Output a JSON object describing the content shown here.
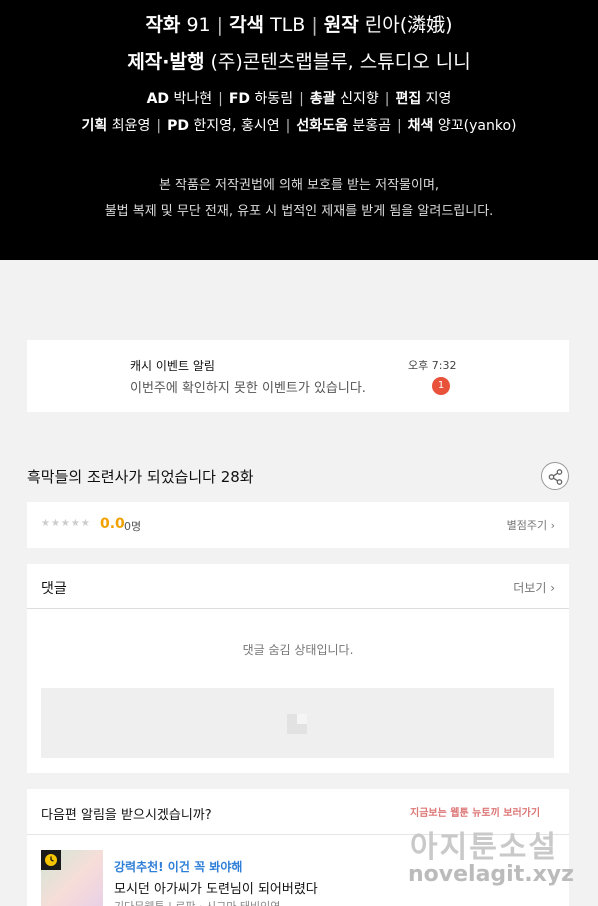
{
  "credits": {
    "line1": [
      {
        "role": "작화",
        "name": "91"
      },
      {
        "role": "각색",
        "name": "TLB"
      },
      {
        "role": "원작",
        "name": "린아(潾娥)"
      }
    ],
    "line2": {
      "role": "제작·발행",
      "name": "(주)콘텐츠랩블루, 스튜디오 니니"
    },
    "line3": [
      {
        "role": "AD",
        "name": "박나현"
      },
      {
        "role": "FD",
        "name": "하동림"
      },
      {
        "role": "총괄",
        "name": "신지향"
      },
      {
        "role": "편집",
        "name": "지영"
      }
    ],
    "line4": [
      {
        "role": "기획",
        "name": "최윤영"
      },
      {
        "role": "PD",
        "name": "한지영, 홍시연"
      },
      {
        "role": "선화도움",
        "name": "분홍곰"
      },
      {
        "role": "채색",
        "name": "양꼬(yanko)"
      }
    ],
    "notice1": "본 작품은 저작권법에 의해 보호를 받는 저작물이며,",
    "notice2": "불법 복제 및 무단 전재, 유포 시 법적인 제재를 받게 됨을 알려드립니다."
  },
  "event_notice": {
    "title": "캐시 이벤트 알림",
    "message": "이번주에 확인하지 못한 이벤트가 있습니다.",
    "time": "오후 7:32",
    "badge": "1"
  },
  "episode": {
    "title": "흑막들의 조련사가 되었습니다 28화",
    "share_icon": "share-icon"
  },
  "rating": {
    "stars": "★★★★★",
    "score": "0.0",
    "count": "0명",
    "rate_button": "별점주기 ›",
    "score_color": "#f2a100"
  },
  "comments": {
    "label": "댓글",
    "more": "더보기 ›",
    "hidden_message": "댓글 숨김 상태입니다."
  },
  "next_episode": {
    "question": "다음편 알림을 받으시겠습니까?",
    "tag": "강력추천! 이건 꼭 봐야해",
    "title": "모시던 아가씨가 도련님이 되어버렸다",
    "authors": "기다무웹툰 | 로판 · 시그마 태비인연",
    "tag_color": "#2f7fd8"
  },
  "watermark": {
    "line1": "지금보는 웹툰 뉴토끼 보러가기",
    "line2": "아지툰소설",
    "line3": "novelagit.xyz"
  }
}
